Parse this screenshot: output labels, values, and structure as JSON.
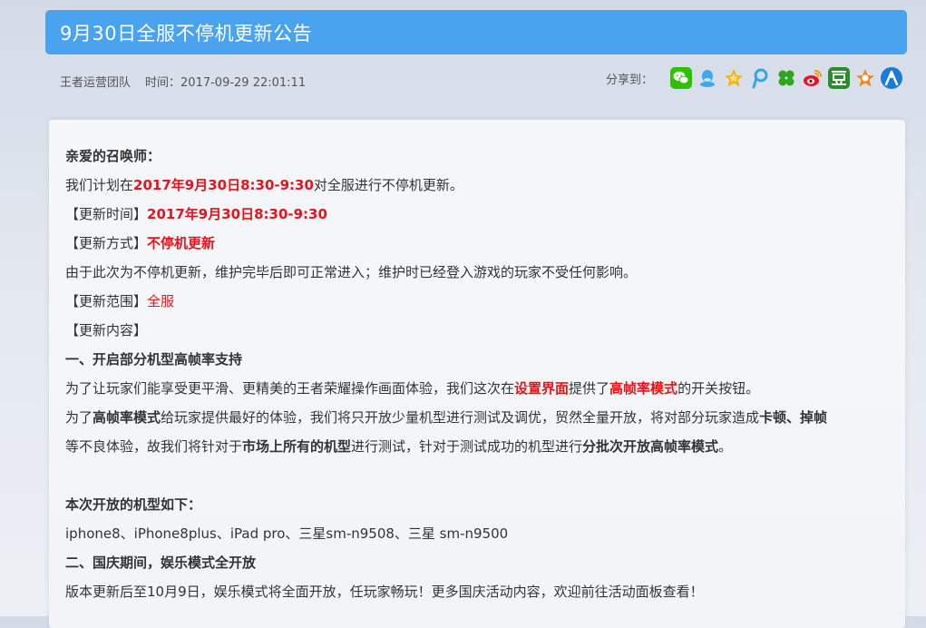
{
  "title": "9月30日全服不停机更新公告",
  "meta": {
    "author": "王者运营团队",
    "time_label": "时间：",
    "time_value": "2017-09-29 22:01:11"
  },
  "share": {
    "label": "分享到：",
    "icons": [
      "wechat-icon",
      "qq-icon",
      "qzone-icon",
      "tencent-weibo-icon",
      "pengyou-icon",
      "sina-weibo-icon",
      "douban-icon",
      "kaixin-icon",
      "renren-icon"
    ],
    "colors": {
      "wechat": "#2dc100",
      "qq": "#3fa7f1",
      "qzone": "#f5b400",
      "tencent_weibo": "#34a7e0",
      "pengyou": "#2ea61e",
      "sina_weibo": "#e6162d",
      "douban": "#2b8c2e",
      "kaixin": "#f08a1f",
      "renren": "#1b7cd6"
    }
  },
  "body": {
    "greeting": "亲爱的召唤师：",
    "l1_a": "我们计划在",
    "l1_b": "2017年9月30日8:30-9:30",
    "l1_c": "对全服进行不停机更新。",
    "l2_a": "【更新时间】",
    "l2_b": "2017年9月30日8:30-9:30",
    "l3_a": "【更新方式】",
    "l3_b": "不停机更新",
    "l4": "由于此次为不停机更新，维护完毕后即可正常进入；维护时已经登入游戏的玩家不受任何影响。",
    "l5_a": "【更新范围】",
    "l5_b": "全服",
    "l6": "【更新内容】",
    "h1": "一、开启部分机型高帧率支持",
    "l7_a": "为了让玩家们能享受更平滑、更精美的王者荣耀操作画面体验，我们这次在",
    "l7_b": "设置界面",
    "l7_c": "提供了",
    "l7_d": "高帧率模式",
    "l7_e": "的开关按钮。",
    "l8_a": "为了",
    "l8_b": "高帧率模式",
    "l8_c": "给玩家提供最好的体验，我们将只开放少量机型进行测试及调优，贸然全量开放，将对部分玩家造成",
    "l8_d": "卡顿、掉帧",
    "l9_a": "等不良体验，故我们将针对于",
    "l9_b": "市场上所有的机型",
    "l9_c": "进行测试，针对于测试成功的机型进行",
    "l9_d": "分批次开放高帧率模式",
    "l9_e": "。",
    "h2": "本次开放的机型如下：",
    "l10": "iphone8、iPhone8plus、iPad pro、三星sm-n9508、三星 sm-n9500",
    "h3": "二、国庆期间，娱乐模式全开放",
    "l11": "版本更新后至10月9日，娱乐模式将全面开放，任玩家畅玩！更多国庆活动内容，欢迎前往活动面板查看！"
  }
}
